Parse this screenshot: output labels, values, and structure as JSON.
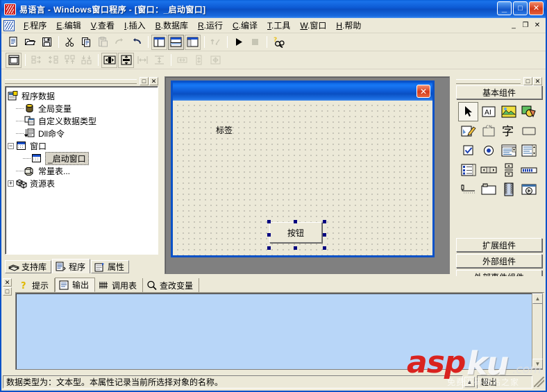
{
  "window": {
    "title": "易语言 - Windows窗口程序 - [窗口：_启动窗口]",
    "icon": "yi-logo-icon",
    "minimize_label": "_",
    "maximize_label": "□",
    "close_label": "✕"
  },
  "menubar": {
    "icon": "yi-logo-small-icon",
    "items": [
      {
        "mnemonic": "F",
        "label": ".程序"
      },
      {
        "mnemonic": "E",
        "label": ".编辑"
      },
      {
        "mnemonic": "V",
        "label": ".查看"
      },
      {
        "mnemonic": "I",
        "label": ".插入"
      },
      {
        "mnemonic": "B",
        "label": ".数据库"
      },
      {
        "mnemonic": "R",
        "label": ".运行"
      },
      {
        "mnemonic": "C",
        "label": ".编译"
      },
      {
        "mnemonic": "T",
        "label": ".工具"
      },
      {
        "mnemonic": "W",
        "label": ".窗口"
      },
      {
        "mnemonic": "H",
        "label": ".帮助"
      }
    ],
    "mdi_buttons": [
      "_",
      "❐",
      "✕"
    ]
  },
  "toolbar_main": {
    "items": [
      {
        "name": "new-file-icon",
        "enabled": true
      },
      {
        "name": "open-file-icon",
        "enabled": true
      },
      {
        "name": "save-file-icon",
        "enabled": true
      },
      {
        "name": "separator"
      },
      {
        "name": "cut-icon",
        "enabled": true
      },
      {
        "name": "copy-icon",
        "enabled": true
      },
      {
        "name": "paste-icon",
        "enabled": false
      },
      {
        "name": "redo-icon",
        "enabled": false
      },
      {
        "name": "undo-icon",
        "enabled": true
      },
      {
        "name": "separator"
      },
      {
        "name": "layout-columns-icon",
        "enabled": true
      },
      {
        "name": "layout-rows-icon",
        "enabled": true,
        "pressed": true
      },
      {
        "name": "layout-mixed-icon",
        "enabled": true
      },
      {
        "name": "separator"
      },
      {
        "name": "insert-statement-icon",
        "enabled": false
      },
      {
        "name": "separator"
      },
      {
        "name": "run-icon",
        "enabled": true
      },
      {
        "name": "stop-icon",
        "enabled": false
      },
      {
        "name": "separator"
      },
      {
        "name": "find-help-icon",
        "enabled": true
      }
    ]
  },
  "toolbar_align": {
    "items": [
      {
        "name": "form-grid-icon",
        "enabled": true
      },
      {
        "name": "separator"
      },
      {
        "name": "align-left-icon",
        "enabled": false
      },
      {
        "name": "align-right-icon",
        "enabled": false
      },
      {
        "name": "align-top-icon",
        "enabled": false
      },
      {
        "name": "align-bottom-icon",
        "enabled": false
      },
      {
        "name": "separator"
      },
      {
        "name": "center-horizontal-icon",
        "enabled": true
      },
      {
        "name": "center-vertical-icon",
        "enabled": true
      },
      {
        "name": "space-horizontal-icon",
        "enabled": false
      },
      {
        "name": "space-vertical-icon",
        "enabled": false
      },
      {
        "name": "separator"
      },
      {
        "name": "same-width-icon",
        "enabled": false
      },
      {
        "name": "same-height-icon",
        "enabled": false
      },
      {
        "name": "same-size-icon",
        "enabled": false
      }
    ]
  },
  "left_panel": {
    "restore_label": "❐",
    "close_label": "✕",
    "tree": [
      {
        "label": "程序数据",
        "icon": "program-data-icon",
        "indent": 0,
        "expander": "none",
        "selected": false
      },
      {
        "label": "全局变量",
        "icon": "global-var-icon",
        "indent": 1,
        "expander": "none",
        "selected": false
      },
      {
        "label": "自定义数据类型",
        "icon": "custom-type-icon",
        "indent": 1,
        "expander": "none",
        "selected": false
      },
      {
        "label": "Dll命令",
        "icon": "dll-command-icon",
        "indent": 1,
        "expander": "none",
        "selected": false
      },
      {
        "label": "窗口",
        "icon": "window-folder-icon",
        "indent": 1,
        "expander": "minus",
        "selected": false
      },
      {
        "label": "_启动窗口",
        "icon": "window-icon",
        "indent": 2,
        "expander": "none",
        "selected": true
      },
      {
        "label": "常量表...",
        "icon": "constant-table-icon",
        "indent": 1,
        "expander": "none",
        "selected": false
      },
      {
        "label": "资源表",
        "icon": "resource-table-icon",
        "indent": 1,
        "expander": "plus",
        "selected": false
      }
    ],
    "tabs": [
      {
        "label": "支持库",
        "icon": "library-icon",
        "active": false
      },
      {
        "label": "程序",
        "icon": "program-icon",
        "active": true
      },
      {
        "label": "属性",
        "icon": "properties-icon",
        "active": false
      }
    ]
  },
  "designer": {
    "form_title": "",
    "form_close_label": "✕",
    "controls": [
      {
        "type": "label",
        "name": "标签",
        "text": "标签",
        "selected": false
      },
      {
        "type": "button",
        "name": "按钮",
        "text": "按钮",
        "selected": true
      }
    ]
  },
  "right_panel": {
    "restore_label": "❐",
    "close_label": "✕",
    "group_basic": "基本组件",
    "group_extended": "扩展组件",
    "group_external": "外部组件",
    "group_external_event": "外部事件组件",
    "components": [
      {
        "name": "pointer-tool-icon",
        "selected": true
      },
      {
        "name": "label-tool-icon",
        "selected": false
      },
      {
        "name": "picture-tool-icon",
        "selected": false
      },
      {
        "name": "picture-box-tool-icon",
        "selected": false
      },
      {
        "name": "edit-box-tool-icon",
        "selected": false
      },
      {
        "name": "group-box-tool-icon",
        "selected": false
      },
      {
        "name": "text-tool-icon",
        "selected": false
      },
      {
        "name": "button-tool-icon",
        "selected": false
      },
      {
        "name": "checkbox-tool-icon",
        "selected": false
      },
      {
        "name": "radio-tool-icon",
        "selected": false
      },
      {
        "name": "combo-box-tool-icon",
        "selected": false
      },
      {
        "name": "list-box-tool-icon",
        "selected": false
      },
      {
        "name": "list-view-tool-icon",
        "selected": false
      },
      {
        "name": "scrollbar-horizontal-tool-icon",
        "selected": false
      },
      {
        "name": "spin-tool-icon",
        "selected": false
      },
      {
        "name": "progress-bar-tool-icon",
        "selected": false
      },
      {
        "name": "track-bar-tool-icon",
        "selected": false
      },
      {
        "name": "tab-control-tool-icon",
        "selected": false
      },
      {
        "name": "image-list-tool-icon",
        "selected": false
      },
      {
        "name": "media-tool-icon",
        "selected": false
      }
    ]
  },
  "bottom_panel": {
    "close_label": "✕",
    "restore_label": "❐",
    "tabs": [
      {
        "label": "提示",
        "icon": "hint-icon",
        "active": false
      },
      {
        "label": "输出",
        "icon": "output-icon",
        "active": true
      },
      {
        "label": "调用表",
        "icon": "call-table-icon",
        "active": false
      },
      {
        "label": "查改变量",
        "icon": "search-variable-icon",
        "active": false
      }
    ],
    "output_text": "",
    "scroll_up_label": "▲",
    "scroll_down_label": "▼"
  },
  "statusbar": {
    "message": "数据类型为：文本型。本属性记录当前所选择对象的名称。",
    "updown_label": "▲",
    "right_label": "超出"
  },
  "watermark": {
    "asp": "asp",
    "ku": "ku",
    "com": ".com",
    "cn_text": "免费源码网站之家"
  },
  "colors": {
    "titlebar_blue": "#0a52c8",
    "face": "#ece9d8",
    "output_blue": "#b8d6f8",
    "selection_handle": "#000080",
    "watermark_red": "#d9231f"
  }
}
